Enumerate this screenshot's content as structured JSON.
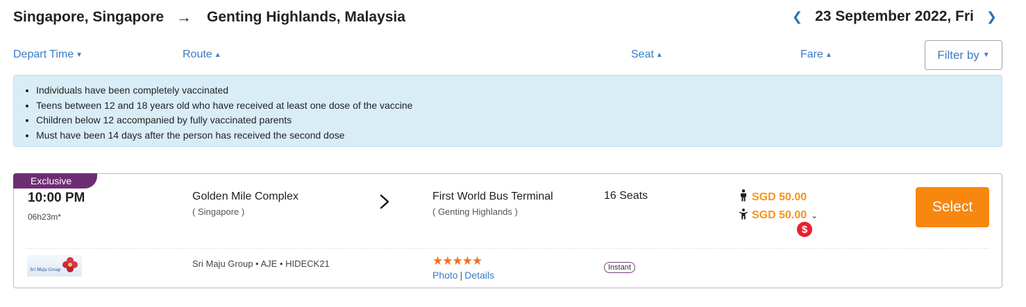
{
  "header": {
    "origin": "Singapore, Singapore",
    "arrow": "→",
    "destination": "Genting Highlands, Malaysia",
    "date": "23 September 2022, Fri",
    "prev_icon": "chevron-left-icon",
    "next_icon": "chevron-right-icon"
  },
  "sort_bar": {
    "depart_time": "Depart Time",
    "route": "Route",
    "seat": "Seat",
    "fare": "Fare",
    "filter": "Filter by"
  },
  "notice": {
    "items": [
      "Individuals have been completely vaccinated",
      "Teens between 12 and 18 years old who have received at least one dose of the vaccine",
      "Children below 12 accompanied by fully vaccinated parents",
      "Must have been 14 days after the person has received the second dose"
    ]
  },
  "trip": {
    "badge": "Exclusive",
    "depart_time": "10:00 PM",
    "duration": "06h23m*",
    "from_name": "Golden Mile Complex",
    "from_city": "( Singapore )",
    "to_name": "First World Bus Terminal",
    "to_city": "( Genting Highlands )",
    "seats": "16 Seats",
    "adult_fare": "SGD 50.00",
    "child_fare": "SGD 50.00",
    "promo_symbol": "$",
    "select": "Select",
    "operator_logo_text": "Sri Maju Group",
    "operator_info": "Sri Maju Group • AJE • HIDECK21",
    "rating": 5,
    "stars": "★★★★★",
    "photo": "Photo",
    "details": "Details",
    "link_separator": "|",
    "instant": "Instant"
  },
  "colors": {
    "accent_blue": "#3a7cc2",
    "price_orange": "#f7941d",
    "select_orange": "#f7870f",
    "badge_purple": "#6d2d73",
    "notice_bg": "#d9edf7",
    "promo_red": "#e8202a",
    "star_orange": "#f36f21"
  }
}
